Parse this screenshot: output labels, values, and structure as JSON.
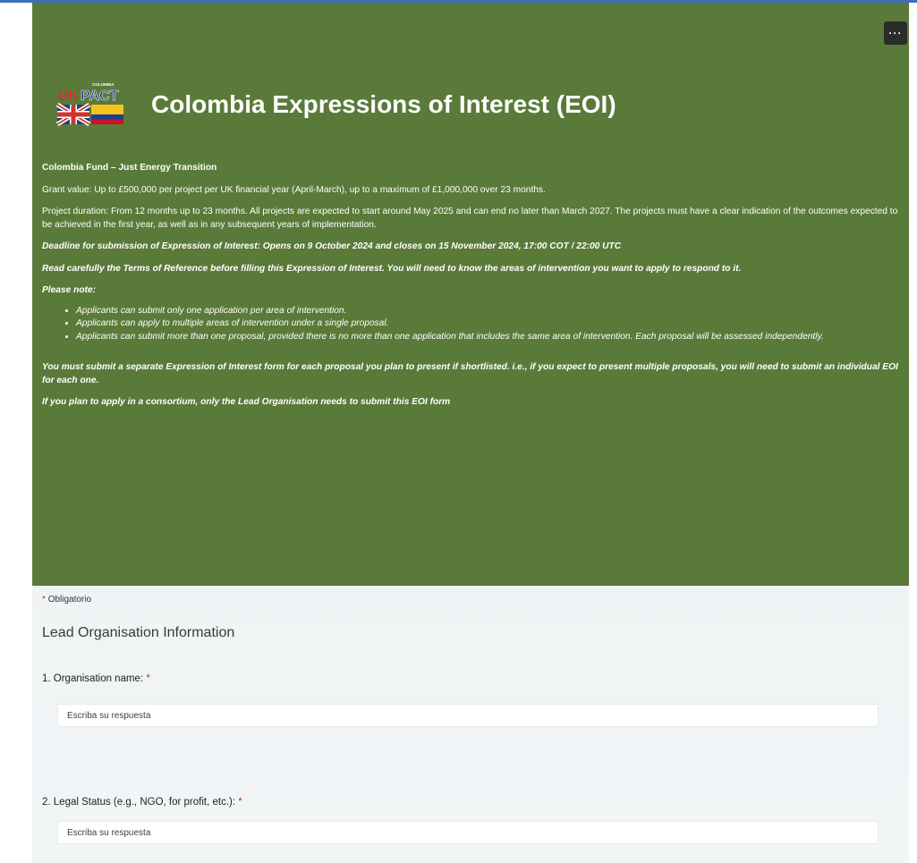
{
  "header": {
    "title": "Colombia Expressions of Interest (EOI)",
    "more_label": "···",
    "logo": {
      "top_text": "COLOMBIA",
      "uk": "UK",
      "pact": "PACT"
    },
    "fund_title": "Colombia Fund – Just Energy Transition",
    "grant_value": "Grant value: Up to £500,000 per project per UK financial year (April-March), up to a maximum of £1,000,000 over 23 months.",
    "project_duration": "Project duration: From 12 months up to 23 months. All projects are expected to start around May 2025 and can end no later than March 2027. The projects must have a clear indication of the outcomes expected to be achieved in the first year, as well as in any subsequent years of implementation.",
    "deadline": "Deadline for submission of Expression of Interest: Opens on 9 October 2024 and closes on 15 November 2024, 17:00 COT / 22:00 UTC",
    "read_carefully": "Read carefully the Terms of Reference before filling this Expression of Interest. You will need to know the areas of intervention you want to apply to respond to it.",
    "please_note": "Please note:",
    "bullets": [
      "Applicants can submit only one application per area of intervention.",
      "Applicants can apply to multiple areas of intervention under a single proposal.",
      "Applicants can submit more than one proposal, provided there is no more than one application that includes the same area of intervention. Each proposal will be assessed independently."
    ],
    "separate_form": "You must submit a separate Expression of Interest form for each proposal you plan to present if shortlisted. i.e., if you expect to present multiple proposals, you will need to submit an individual EOI for each one.",
    "consortium": "If you plan to apply in a consortium, only the Lead Organisation needs to submit this EOI form"
  },
  "form": {
    "required_note": "Obligatorio",
    "section_title": "Lead Organisation Information",
    "questions": [
      {
        "label": "1. Organisation name:",
        "placeholder": "Escriba su respuesta"
      },
      {
        "label": "2. Legal Status (e.g., NGO, for profit, etc.):",
        "placeholder": "Escriba su respuesta"
      }
    ]
  },
  "colors": {
    "header_bg": "#5a7a39",
    "required_star": "#c0392b",
    "uk_red": "#d0352b",
    "pact_blue": "#1f3f8a",
    "col_yellow": "#f7c31a",
    "col_blue": "#1c3f94",
    "col_red": "#ce1126"
  }
}
